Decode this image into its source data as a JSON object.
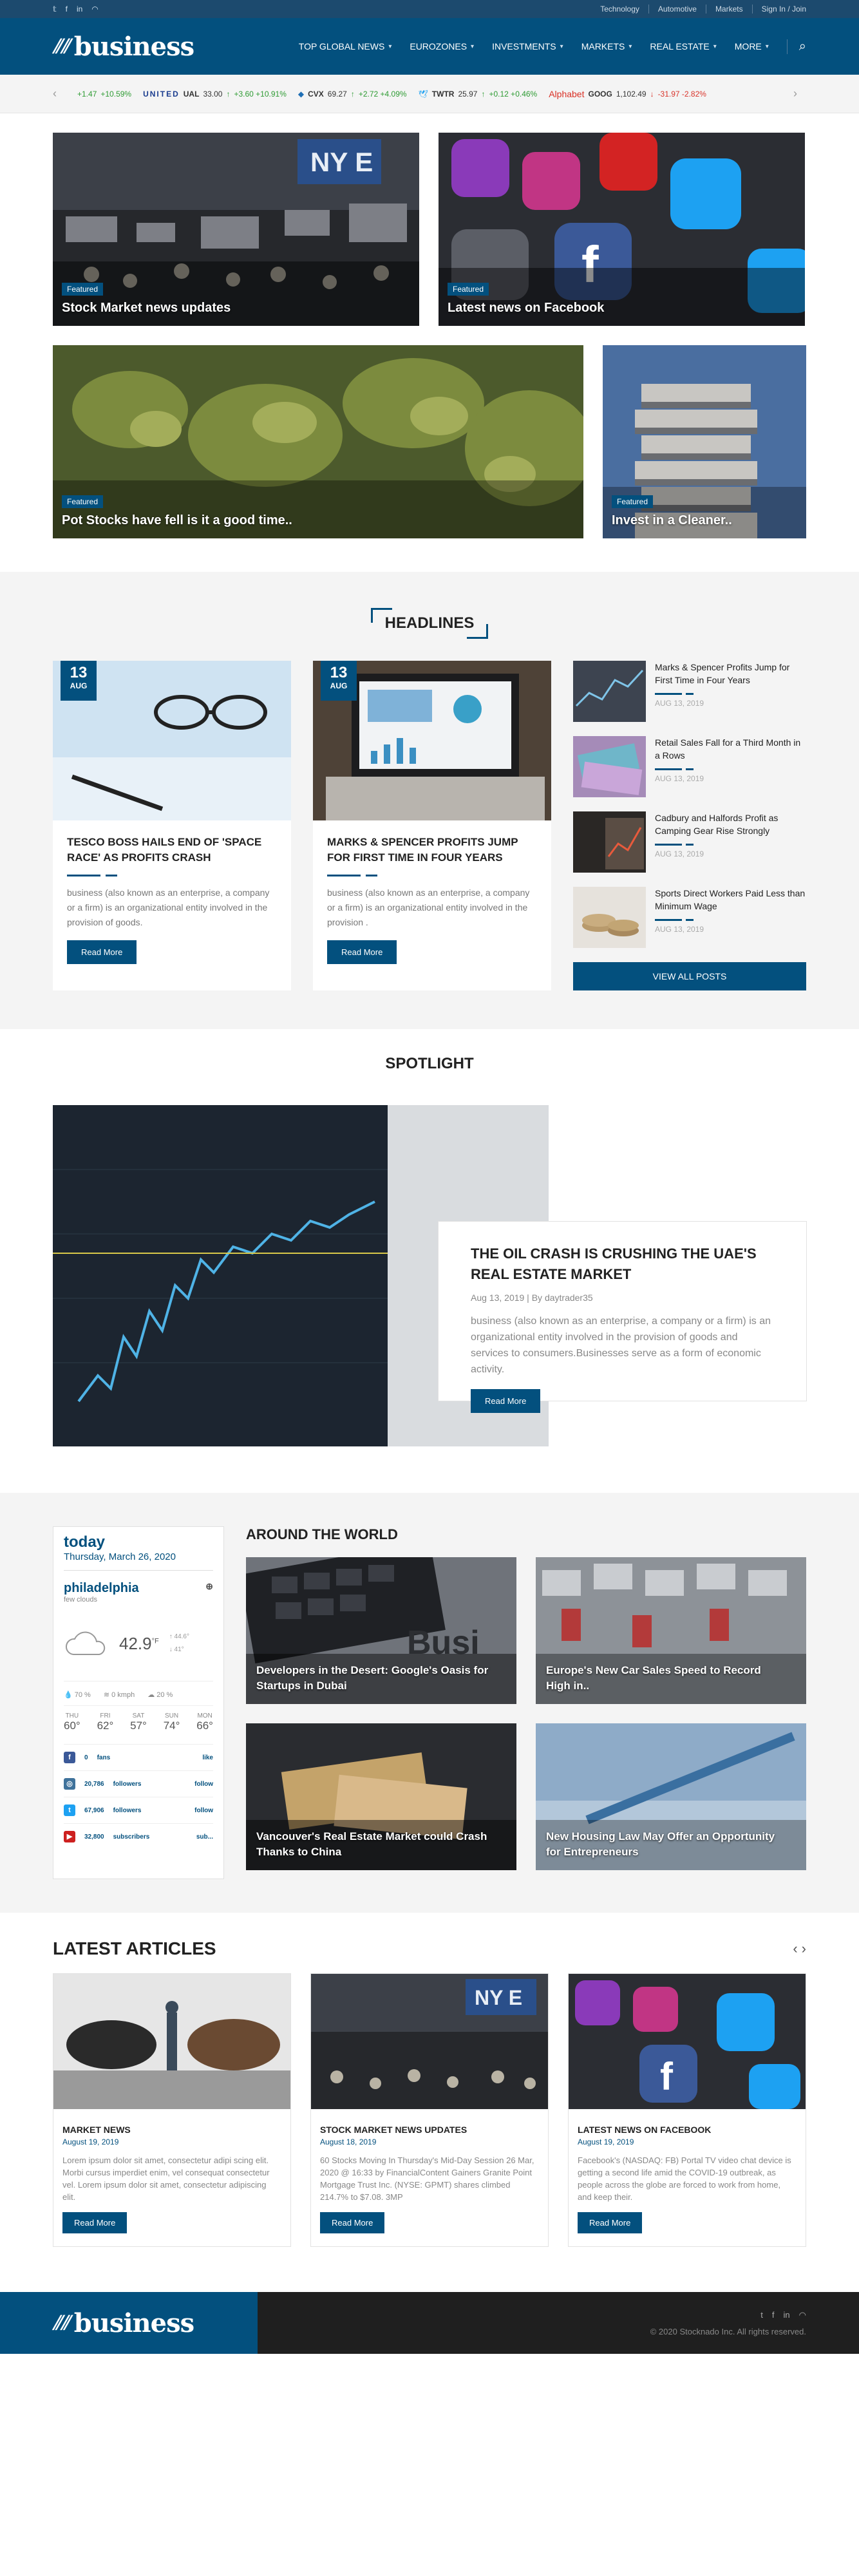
{
  "topbar": {
    "social": [
      "t",
      "f",
      "in",
      "rss"
    ],
    "links": [
      "Technology",
      "Automotive",
      "Markets"
    ],
    "signin": "Sign In / Join"
  },
  "header": {
    "logo": "business",
    "nav": [
      "TOP GLOBAL NEWS",
      "EUROZONES",
      "INVESTMENTS",
      "MARKETS",
      "REAL ESTATE",
      "MORE"
    ]
  },
  "ticker": [
    {
      "brand": "",
      "sym": "",
      "price": "+1.47",
      "chg": "+10.59%",
      "dir": "up"
    },
    {
      "brand": "UNITED",
      "sym": "UAL",
      "price": "33.00",
      "chg": "+3.60 +10.91%",
      "dir": "up"
    },
    {
      "brand": "",
      "sym": "CVX",
      "price": "69.27",
      "chg": "+2.72 +4.09%",
      "dir": "up"
    },
    {
      "brand": "",
      "sym": "TWTR",
      "price": "25.97",
      "chg": "+0.12 +0.46%",
      "dir": "up"
    },
    {
      "brand": "Alphabet",
      "sym": "GOOG",
      "price": "1,102.49",
      "chg": "-31.97 -2.82%",
      "dir": "dn"
    }
  ],
  "featured": [
    {
      "badge": "Featured",
      "title": "Stock Market news updates"
    },
    {
      "badge": "Featured",
      "title": "Latest news on Facebook"
    },
    {
      "badge": "Featured",
      "title": "Pot Stocks have fell is it a good time.."
    },
    {
      "badge": "Featured",
      "title": "Invest in a Cleaner.."
    }
  ],
  "headlines": {
    "title": "HEADLINES",
    "cards": [
      {
        "day": "13",
        "month": "AUG",
        "title": "TESCO BOSS HAILS END OF 'SPACE RACE' AS PROFITS CRASH",
        "excerpt": "business (also known as an enterprise, a company or a firm) is an organizational entity involved in the provision of goods.",
        "button": "Read More"
      },
      {
        "day": "13",
        "month": "AUG",
        "title": "MARKS & SPENCER PROFITS JUMP FOR FIRST TIME IN FOUR YEARS",
        "excerpt": "business (also known as an enterprise, a company or a firm) is an organizational entity involved in the provision .",
        "button": "Read More"
      }
    ],
    "side": [
      {
        "title": "Marks & Spencer Profits Jump for First Time in Four Years",
        "date": "AUG 13, 2019"
      },
      {
        "title": "Retail Sales Fall for a Third Month in a Rows",
        "date": "AUG 13, 2019"
      },
      {
        "title": "Cadbury and Halfords Profit as Camping Gear Rise Strongly",
        "date": "AUG 13, 2019"
      },
      {
        "title": "Sports Direct Workers Paid Less than Minimum Wage",
        "date": "AUG 13, 2019"
      }
    ],
    "viewall": "VIEW ALL POSTS"
  },
  "spotlight": {
    "title": "SPOTLIGHT",
    "heading": "THE OIL CRASH IS CRUSHING THE UAE'S REAL ESTATE MARKET",
    "meta": "Aug 13, 2019   |   By daytrader35",
    "excerpt": "business (also known as an enterprise, a company or a firm) is an organizational entity involved in the provision of goods and services to consumers.Businesses serve as a form of economic activity.",
    "button": "Read More"
  },
  "weather": {
    "today": "today",
    "date": "Thursday, March 26, 2020",
    "city": "philadelphia",
    "cond": "few clouds",
    "temp": "42.9",
    "unit": "°F",
    "hi": "44.6°",
    "lo": "41°",
    "humidity": "70 %",
    "wind": "0 kmph",
    "clouds": "20 %",
    "days": [
      {
        "n": "THU",
        "t": "60°"
      },
      {
        "n": "FRI",
        "t": "62°"
      },
      {
        "n": "SAT",
        "t": "57°"
      },
      {
        "n": "SUN",
        "t": "74°"
      },
      {
        "n": "MON",
        "t": "66°"
      }
    ],
    "social": [
      {
        "icon": "f",
        "count": "0",
        "label": "fans",
        "action": "like",
        "color": "#3b5998"
      },
      {
        "icon": "in",
        "count": "20,786",
        "label": "followers",
        "action": "follow",
        "color": "#3f729b"
      },
      {
        "icon": "t",
        "count": "67,906",
        "label": "followers",
        "action": "follow",
        "color": "#1da1f2"
      },
      {
        "icon": "yt",
        "count": "32,800",
        "label": "subscribers",
        "action": "sub...",
        "color": "#cd201f"
      }
    ]
  },
  "around": {
    "title": "AROUND THE WORLD",
    "items": [
      "Developers in the Desert: Google's Oasis for Startups in Dubai",
      "Europe's New Car Sales Speed to Record High in..",
      "Vancouver's Real Estate Market could Crash Thanks to China",
      "New Housing Law May Offer an Opportunity for Entrepreneurs"
    ]
  },
  "latest": {
    "title": "LATEST ARTICLES",
    "cards": [
      {
        "title": "MARKET NEWS",
        "date": "August 19, 2019",
        "text": "Lorem ipsum dolor sit amet, consectetur adipi scing elit. Morbi cursus imperdiet enim, vel consequat consectetur vel. Lorem ipsum dolor sit amet, consectetur adipiscing elit.",
        "button": "Read More"
      },
      {
        "title": "STOCK MARKET NEWS UPDATES",
        "date": "August 18, 2019",
        "text": "60 Stocks Moving In Thursday's Mid-Day Session 26 Mar, 2020 @ 16:33 by FinancialContent Gainers Granite Point Mortgage Trust Inc. (NYSE: GPMT) shares climbed 214.7% to $7.08. 3MP",
        "button": "Read More"
      },
      {
        "title": "LATEST NEWS ON FACEBOOK",
        "date": "August 19, 2019",
        "text": "Facebook's (NASDAQ: FB) Portal TV video chat device is getting a second life amid the COVID-19 outbreak, as people across the globe are forced to work from home, and keep their.",
        "button": "Read More"
      }
    ]
  },
  "footer": {
    "logo": "business",
    "copy": "© 2020 Stocknado Inc. All rights reserved."
  }
}
